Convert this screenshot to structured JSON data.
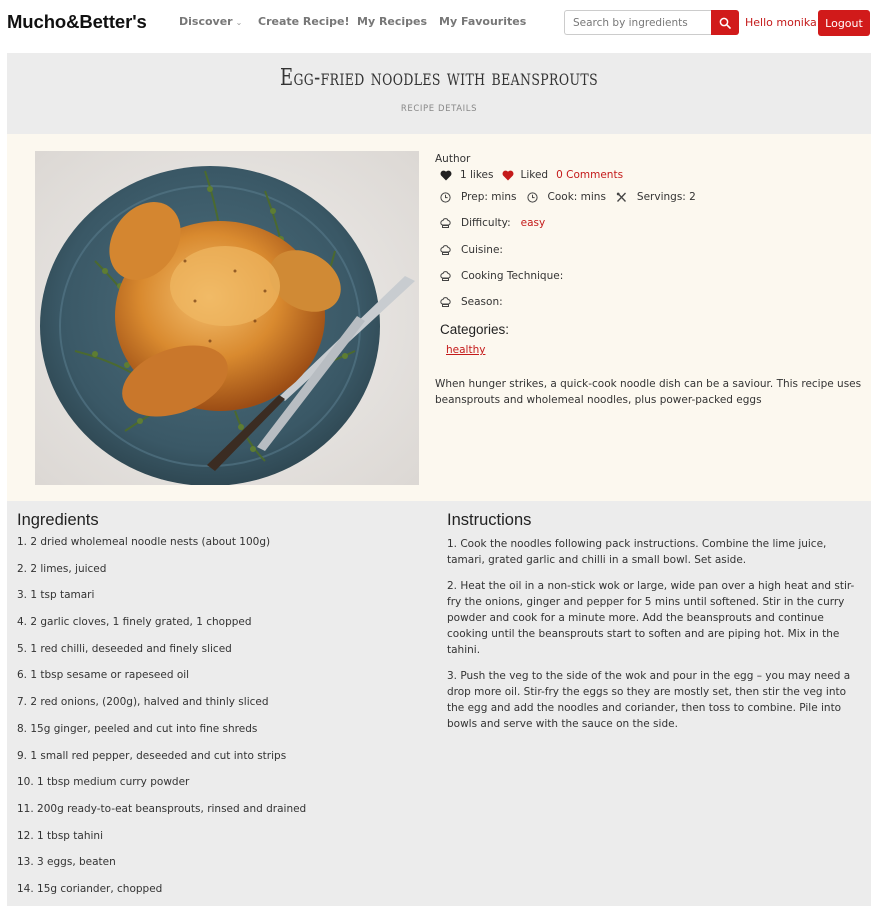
{
  "nav": {
    "brand": "Mucho&Better's",
    "links": [
      {
        "label": "Discover",
        "has_caret": true
      },
      {
        "label": "Create Recipe!"
      },
      {
        "label": "My Recipes"
      },
      {
        "label": "My Favourites"
      }
    ],
    "search_placeholder": "Search by ingredients",
    "greeting": "Hello monika!",
    "logout_label": "Logout",
    "accent_color": "#d11a1a"
  },
  "recipe": {
    "title": "Egg-fried noodles with beansprouts",
    "subtitle": "RECIPE DETAILS",
    "image_icon": "roast-chicken-photo",
    "author_label": "Author",
    "likes": "1 likes",
    "liked_label": "Liked",
    "comments": "0 Comments",
    "prep": "Prep: mins",
    "cook": "Cook: mins",
    "servings": "Servings: 2",
    "difficulty_label": "Difficulty:",
    "difficulty_value": "easy",
    "cuisine_label": "Cuisine:",
    "technique_label": "Cooking Technique:",
    "season_label": "Season:",
    "categories_heading": "Categories:",
    "categories": [
      "healthy"
    ],
    "description": "When hunger strikes, a quick-cook noodle dish can be a saviour. This recipe uses beansprouts and wholemeal noodles, plus power-packed eggs"
  },
  "ingredients": {
    "heading": "Ingredients",
    "items": [
      "1. 2 dried wholemeal noodle nests (about 100g)",
      "2. 2 limes, juiced",
      "3. 1 tsp tamari",
      "4. 2 garlic cloves, 1 finely grated, 1 chopped",
      "5. 1 red chilli, deseeded and finely sliced",
      "6. 1 tbsp sesame or rapeseed oil",
      "7. 2 red onions, (200g), halved and thinly sliced",
      "8. 15g ginger, peeled and cut into fine shreds",
      "9. 1 small red pepper, deseeded and cut into strips",
      "10. 1 tbsp medium curry powder",
      "11. 200g ready-to-eat beansprouts, rinsed and drained",
      "12. 1 tbsp tahini",
      "13. 3 eggs, beaten",
      "14. 15g coriander, chopped"
    ]
  },
  "instructions": {
    "heading": "Instructions",
    "steps": [
      "1. Cook the noodles following pack instructions. Combine the lime juice, tamari, grated garlic and chilli in a small bowl. Set aside.",
      "2. Heat the oil in a non-stick wok or large, wide pan over a high heat and stir-fry the onions, ginger and pepper for 5 mins until softened. Stir in the curry powder and cook for a minute more. Add the beansprouts and continue cooking until the beansprouts start to soften and are piping hot. Mix in the tahini.",
      "3. Push the veg to the side of the wok and pour in the egg – you may need a drop more oil. Stir-fry the eggs so they are mostly set, then stir the veg into the egg and add the noodles and coriander, then toss to combine. Pile into bowls and serve with the sauce on the side."
    ]
  }
}
